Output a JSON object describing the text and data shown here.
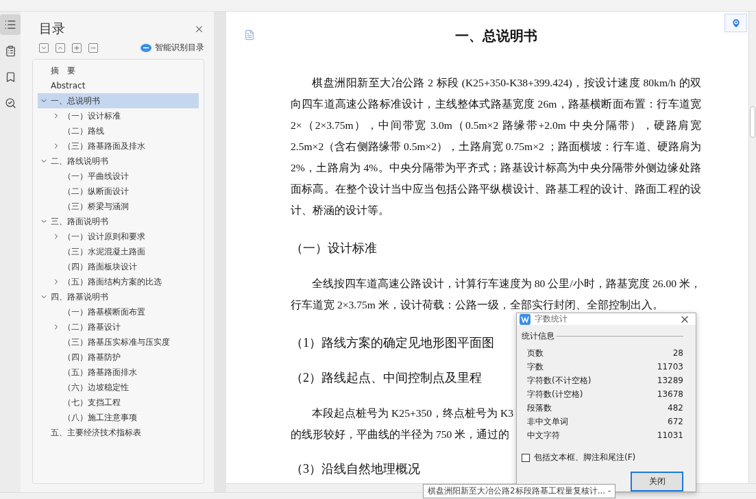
{
  "side_rail": [
    {
      "kind": "outline",
      "selected": true
    },
    {
      "kind": "pages",
      "selected": false
    },
    {
      "kind": "bookmark",
      "selected": false
    },
    {
      "kind": "find",
      "selected": false
    }
  ],
  "toc": {
    "title": "目录",
    "tools": [
      {
        "kind": "expand"
      },
      {
        "kind": "collapse"
      },
      {
        "kind": "add"
      },
      {
        "kind": "remove"
      }
    ],
    "smart_button": "智能识别目录",
    "items": [
      {
        "label": "摘　要",
        "selected": false
      },
      {
        "label": "Abstract",
        "selected": false
      },
      {
        "label": "一、总说明书",
        "selected": true,
        "expanded": true,
        "children": [
          {
            "label": "（一）设计标准",
            "selected": false,
            "expanded": false
          },
          {
            "label": "（二）路线",
            "selected": false
          },
          {
            "label": "（三）路基路面及排水",
            "selected": false,
            "expanded": false
          }
        ]
      },
      {
        "label": "二、路线说明书",
        "selected": false,
        "expanded": true,
        "children": [
          {
            "label": "（一）平曲线设计",
            "selected": false
          },
          {
            "label": "（二）纵断面设计",
            "selected": false
          },
          {
            "label": "（三）桥梁与涵洞",
            "selected": false
          }
        ]
      },
      {
        "label": "三、路面说明书",
        "selected": false,
        "expanded": true,
        "children": [
          {
            "label": "（一）设计原则和要求",
            "selected": false,
            "expanded": false
          },
          {
            "label": "（三）水泥混凝土路面",
            "selected": false
          },
          {
            "label": "（四）路面板块设计",
            "selected": false
          },
          {
            "label": "（五）路面结构方案的比选",
            "selected": false,
            "expanded": false
          }
        ]
      },
      {
        "label": "四、路基说明书",
        "selected": false,
        "expanded": true,
        "children": [
          {
            "label": "（一）路基横断面布置",
            "selected": false
          },
          {
            "label": "（二）路基设计",
            "selected": false,
            "expanded": false
          },
          {
            "label": "（三）路基压实标准与压实度",
            "selected": false
          },
          {
            "label": "（四）路基防护",
            "selected": false
          },
          {
            "label": "（五）路基路面排水",
            "selected": false
          },
          {
            "label": "（六）边坡稳定性",
            "selected": false
          },
          {
            "label": "（七）支挡工程",
            "selected": false
          },
          {
            "label": "（八）施工注意事项",
            "selected": false
          }
        ]
      },
      {
        "label": "五、主要经济技术指标表",
        "selected": false
      }
    ]
  },
  "document": {
    "blocks": [
      {
        "kind": "title",
        "text": "一、总说明书"
      },
      {
        "kind": "paragraph",
        "text": "棋盘洲阳新至大冶公路 2 标段 (K25+350-K38+399.424)，按设计速度 80km/h 的双向四车道高速公路标准设计，主线整体式路基宽度 26m，路基横断面布置：行车道宽 2×（2×3.75m），中间带宽 3.0m（0.5m×2 路缘带+2.0m 中央分隔带），硬路肩宽 2.5m×2（含右侧路缘带 0.5m×2），土路肩宽 0.75m×2 ；路面横坡：行车道、硬路肩为 2%，土路肩为 4%。中央分隔带为平齐式；路基设计标高为中央分隔带外侧边缘处路面标高。在整个设计当中应当包括公路平纵横设计、路基工程的设计、路面工程的设计、桥涵的设计等。"
      },
      {
        "kind": "heading",
        "text": "（一）设计标准"
      },
      {
        "kind": "paragraph",
        "text": "全线按四车道高速公路设计，计算行车速度为 80 公里/小时，路基宽度 26.00 米，行车道宽 2×3.75m 米，设计荷载：公路一级，全部实行封闭、全部控制出入。"
      },
      {
        "kind": "heading",
        "text": "（1）路线方案的确定见地形图平面图"
      },
      {
        "kind": "heading",
        "text": "（2）路线起点、中间控制点及里程"
      },
      {
        "kind": "lines",
        "lines": [
          "本段起点桩号为 K25+350，终点桩号为 K3",
          "的线形较好，平曲线的半径为 750 米，通过的"
        ]
      },
      {
        "kind": "heading",
        "text": "（3）沿线自然地理概况"
      }
    ]
  },
  "word_count_dialog": {
    "title": "字数统计",
    "group": "统计信息",
    "rows": [
      {
        "label": "页数",
        "value": "28"
      },
      {
        "label": "字数",
        "value": "11703"
      },
      {
        "label": "字符数(不计空格)",
        "value": "13289"
      },
      {
        "label": "字符数(计空格)",
        "value": "13678"
      },
      {
        "label": "段落数",
        "value": "482"
      },
      {
        "label": "非中文单词",
        "value": "672"
      },
      {
        "label": "中文字符",
        "value": "11031"
      }
    ],
    "checkbox": {
      "label": "包括文本框、脚注和尾注(F)",
      "checked": false
    },
    "close_button": "关闭"
  },
  "tooltip": "棋盘洲阳新至大冶公路2标段路基工程量复核计... -"
}
